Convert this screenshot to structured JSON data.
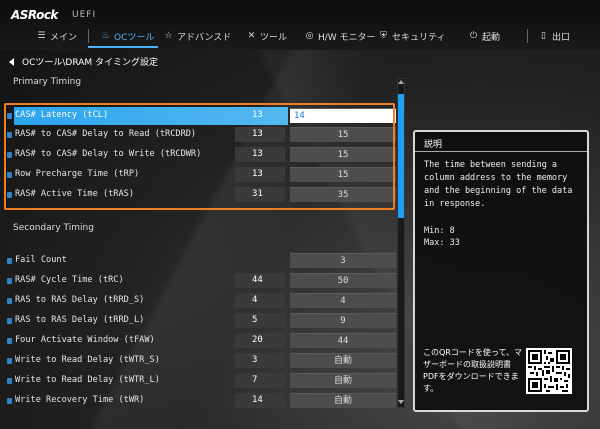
{
  "header": {
    "logo": "ASRock",
    "logo_sub": "UEFI",
    "tabs": [
      {
        "label": "メイン",
        "icon": "menu-icon"
      },
      {
        "label": "OCツール",
        "icon": "flame-icon",
        "active": true
      },
      {
        "label": "アドバンスド",
        "icon": "star-icon"
      },
      {
        "label": "ツール",
        "icon": "tools-icon"
      },
      {
        "label": "H/W モニター",
        "icon": "monitor-icon"
      },
      {
        "label": "セキュリティ",
        "icon": "shield-icon"
      },
      {
        "label": "起動",
        "icon": "power-icon"
      },
      {
        "label": "出口",
        "icon": "exit-icon"
      }
    ]
  },
  "breadcrumb": "OCツール\\DRAM タイミング設定",
  "sections": {
    "primary": "Primary Timing",
    "secondary": "Secondary Timing"
  },
  "primary_rows": [
    {
      "label": "CAS# Latency (tCL)",
      "current": "13",
      "setting": "14"
    },
    {
      "label": "RAS# to CAS# Delay to Read  (tRCDRD)",
      "current": "13",
      "setting": "15"
    },
    {
      "label": "RAS# to CAS# Delay to Write (tRCDWR)",
      "current": "13",
      "setting": "15"
    },
    {
      "label": "Row Precharge Time (tRP)",
      "current": "13",
      "setting": "15"
    },
    {
      "label": "RAS# Active Time (tRAS)",
      "current": "31",
      "setting": "35"
    }
  ],
  "secondary_rows": [
    {
      "label": "Fail Count",
      "current": "",
      "setting": "3"
    },
    {
      "label": "RAS# Cycle Time (tRC)",
      "current": "44",
      "setting": "50"
    },
    {
      "label": "RAS to RAS Delay (tRRD_S)",
      "current": "4",
      "setting": "4"
    },
    {
      "label": "RAS to RAS Delay (tRRD_L)",
      "current": "5",
      "setting": "9"
    },
    {
      "label": "Four Activate Window (tFAW)",
      "current": "20",
      "setting": "44"
    },
    {
      "label": "Write to Read Delay (tWTR_S)",
      "current": "3",
      "setting": "自動"
    },
    {
      "label": "Write to Read Delay (tWTR_L)",
      "current": "7",
      "setting": "自動"
    },
    {
      "label": "Write Recovery Time (tWR)",
      "current": "14",
      "setting": "自動"
    }
  ],
  "description": {
    "title": "説明",
    "text": "The time between sending a\ncolumn address to the memory\nand the beginning of the data\nin response.",
    "minmax": "Min: 8\nMax: 33",
    "qr_text": "このQRコードを使って、マザーボードの取扱説明書PDFをダウンロードできます。"
  },
  "colors": {
    "accent": "#1d9ff2",
    "highlight": "#f07f23"
  }
}
